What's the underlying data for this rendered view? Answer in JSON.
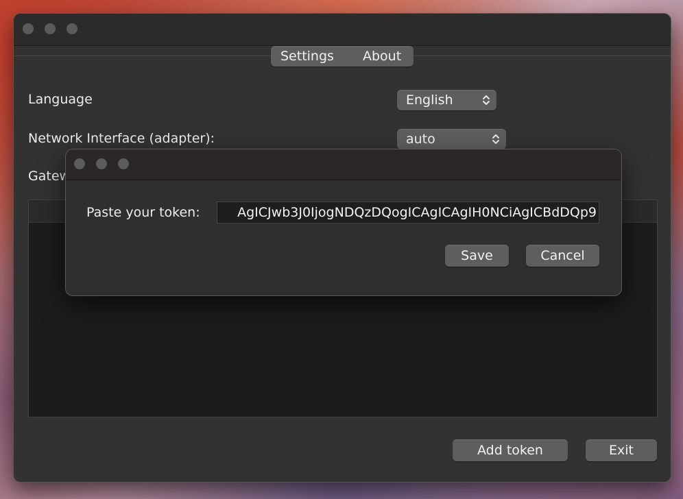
{
  "main_window": {
    "tabs": [
      {
        "label": "Settings",
        "selected": true
      },
      {
        "label": "About",
        "selected": false
      }
    ],
    "settings": {
      "language_label": "Language",
      "language_value": "English",
      "network_label": "Network Interface (adapter):",
      "network_value": "auto",
      "gateway_label_partial": "Gatew"
    },
    "buttons": {
      "add_token": "Add token",
      "exit": "Exit"
    }
  },
  "token_dialog": {
    "prompt_label": "Paste your token:",
    "token_value": "AgICJwb3J0IjogNDQzDQogICAgICAgIH0NCiAgICBdDQp9",
    "buttons": {
      "save": "Save",
      "cancel": "Cancel"
    }
  },
  "icons": {
    "popup_chevron": "chevron-up-down-icon",
    "window_control": "traffic-light-icon"
  },
  "colors": {
    "window_bg": "#323232",
    "titlebar_bg": "#2b2b2b",
    "control_bg": "#5e5e5e",
    "text": "#ececec",
    "list_bg": "#1c1c1c"
  }
}
